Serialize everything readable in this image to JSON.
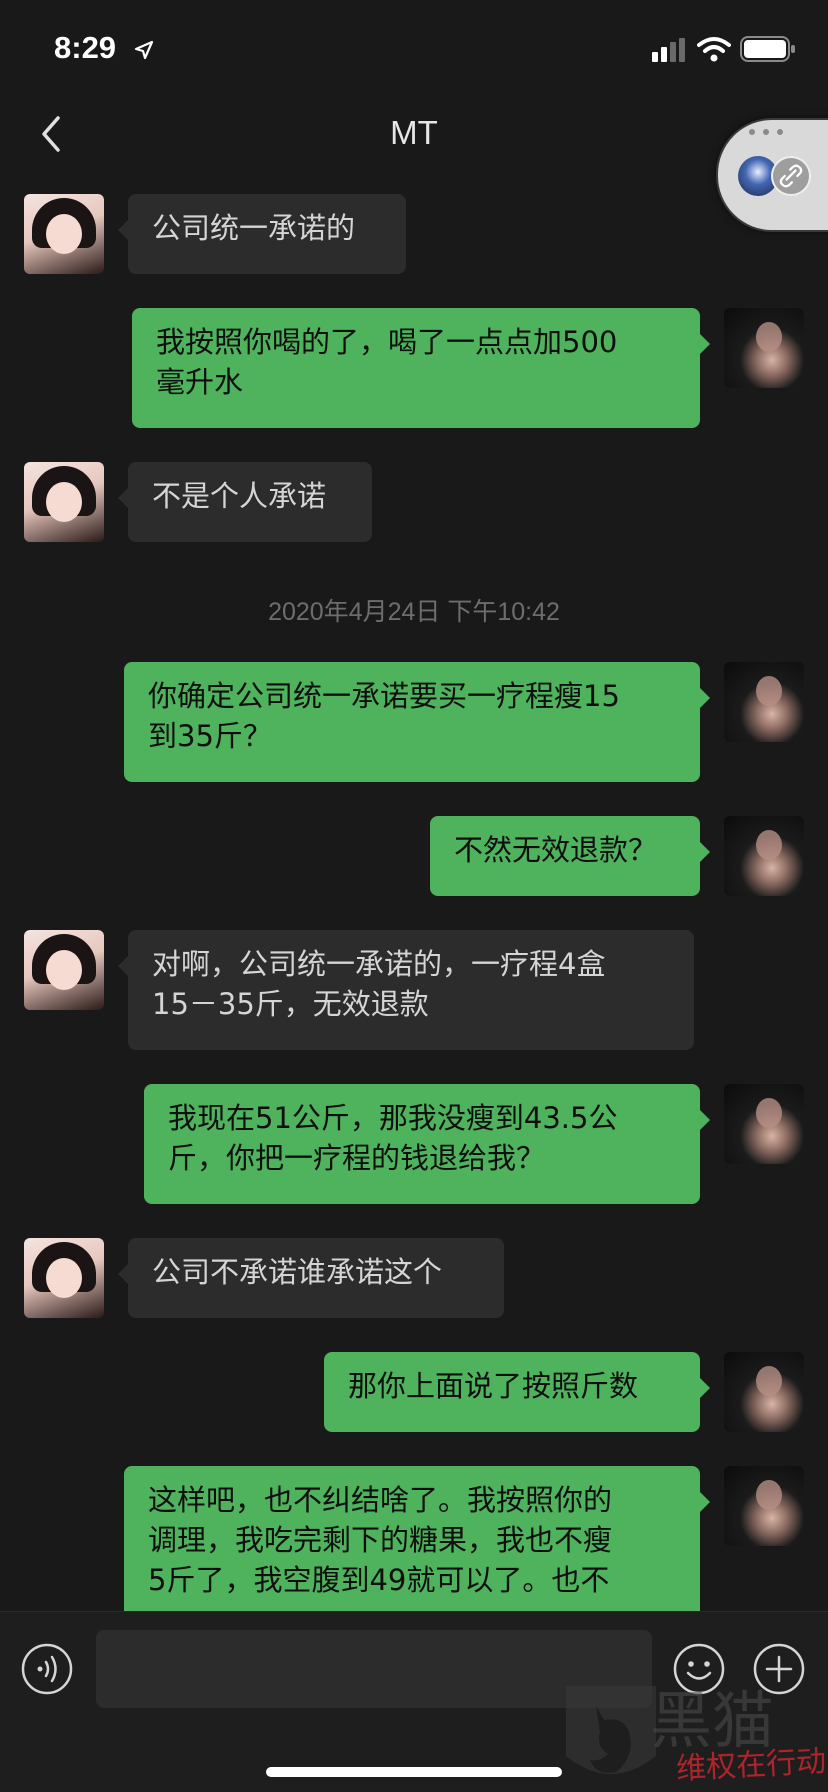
{
  "status_bar": {
    "time": "8:29",
    "icons": [
      "location-arrow-icon",
      "signal-icon",
      "wifi-icon",
      "battery-icon"
    ]
  },
  "nav": {
    "title": "MT",
    "back_icon": "chevron-left-icon"
  },
  "floating_capsule": {
    "icons": [
      "avatar-icon",
      "link-icon"
    ]
  },
  "messages": [
    {
      "side": "in",
      "text_lines": [
        "公司统一承诺的"
      ]
    },
    {
      "side": "out",
      "text_lines": [
        "我按照你喝的了，喝了一点点加500",
        "毫升水"
      ]
    },
    {
      "side": "in",
      "text_lines": [
        "不是个人承诺"
      ]
    },
    {
      "side": "out",
      "text_lines": [
        "你确定公司统一承诺要买一疗程瘦15",
        "到35斤？"
      ]
    },
    {
      "side": "out",
      "text_lines": [
        "不然无效退款？"
      ]
    },
    {
      "side": "in",
      "text_lines": [
        "对啊，公司统一承诺的，一疗程4盒",
        "15－35斤，无效退款"
      ]
    },
    {
      "side": "out",
      "text_lines": [
        "我现在51公斤，那我没瘦到43.5公",
        "斤，你把一疗程的钱退给我？"
      ]
    },
    {
      "side": "in",
      "text_lines": [
        "公司不承诺谁承诺这个"
      ]
    },
    {
      "side": "out",
      "text_lines": [
        "那你上面说了按照斤数"
      ]
    },
    {
      "side": "out",
      "text_lines": [
        "这样吧，也不纠结啥了。我按照你的",
        "调理，我吃完剩下的糖果，我也不瘦",
        "5斤了，我空腹到49就可以了。也不"
      ]
    }
  ],
  "timestamp": "2020年4月24日 下午10:42",
  "input_bar": {
    "placeholder": "",
    "icons": [
      "voice-icon",
      "emoji-icon",
      "plus-icon"
    ]
  },
  "watermark": {
    "text": "维权在行动",
    "brand_glyphs": "黑猫"
  },
  "colors": {
    "background": "#191919",
    "bubble_in": "#2c2c2c",
    "bubble_out": "#4fb25c",
    "text_light": "#d5d5d5",
    "watermark_red": "#c6262e"
  }
}
